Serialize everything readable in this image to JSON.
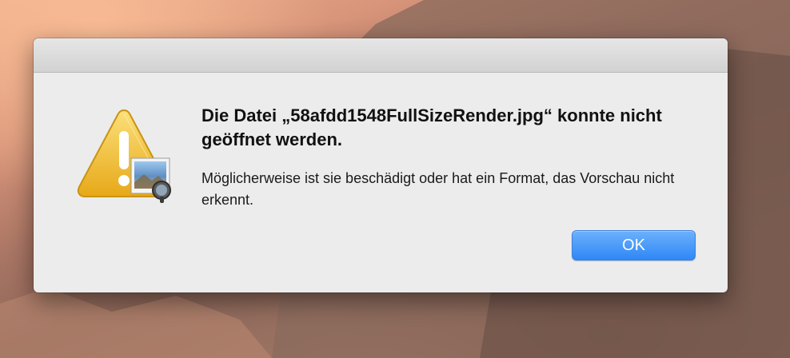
{
  "alert": {
    "title": "Die Datei „58afdd1548FullSizeRender.jpg“ konnte nicht geöffnet werden.",
    "message": "Möglicherweise ist sie beschädigt oder hat ein Format, das Vorschau nicht erkennt.",
    "ok_label": "OK"
  },
  "icons": {
    "warning": "warning-triangle-icon",
    "app": "preview-app-icon"
  },
  "colors": {
    "dialog_background": "#ececec",
    "button_accent": "#2f87f6",
    "warning_yellow": "#f2c12e"
  }
}
